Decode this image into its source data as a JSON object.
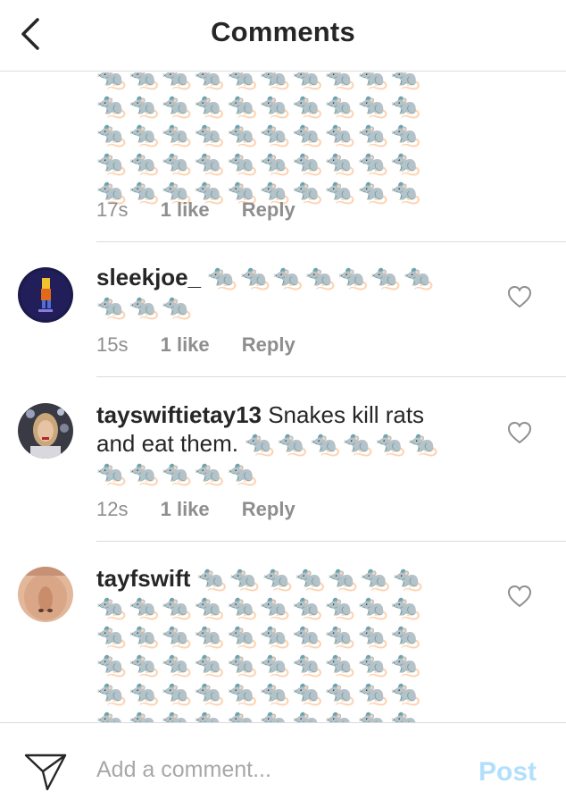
{
  "header": {
    "title": "Comments",
    "back_icon": "chevron-left-icon"
  },
  "rat": "🐀",
  "first_comment": {
    "rat_lines": [
      "🐀🐀🐀🐀🐀🐀🐀🐀🐀🐀",
      "🐀🐀🐀🐀🐀🐀🐀🐀🐀🐀",
      "🐀🐀🐀🐀🐀🐀🐀🐀🐀🐀",
      "🐀🐀🐀🐀🐀🐀🐀🐀🐀🐀",
      "🐀🐀🐀🐀🐀🐀🐀🐀🐀🐀"
    ],
    "time": "17s",
    "likes": "1 like",
    "reply": "Reply"
  },
  "comments": [
    {
      "username": "sleekjoe_",
      "line1_rats": "🐀🐀🐀🐀🐀🐀🐀",
      "line2_rats": "🐀🐀🐀",
      "time": "15s",
      "likes": "1 like",
      "reply": "Reply",
      "heart_icon": "heart-outline-icon"
    },
    {
      "username": "tayswiftietay13",
      "text": "Snakes kill rats",
      "text2": "and eat them.",
      "line2_rats": "🐀🐀🐀🐀🐀🐀",
      "line3_rats": "🐀🐀🐀🐀🐀",
      "time": "12s",
      "likes": "1 like",
      "reply": "Reply",
      "heart_icon": "heart-outline-icon"
    },
    {
      "username": "tayfswift",
      "line1_rats": "🐀🐀🐀🐀🐀🐀🐀",
      "rat_lines": [
        "🐀🐀🐀🐀🐀🐀🐀🐀🐀🐀",
        "🐀🐀🐀🐀🐀🐀🐀🐀🐀🐀",
        "🐀🐀🐀🐀🐀🐀🐀🐀🐀🐀",
        "🐀🐀🐀🐀🐀🐀🐀🐀🐀🐀",
        "🐀🐀🐀🐀🐀🐀🐀🐀🐀🐀"
      ],
      "heart_icon": "heart-outline-icon"
    }
  ],
  "footer": {
    "placeholder": "Add a comment...",
    "post_label": "Post",
    "send_icon": "paper-plane-icon",
    "post_color": "#b2dffc"
  },
  "colors": {
    "text": "#262626",
    "meta": "#8e8e8e",
    "divider": "#dbdbdb"
  }
}
